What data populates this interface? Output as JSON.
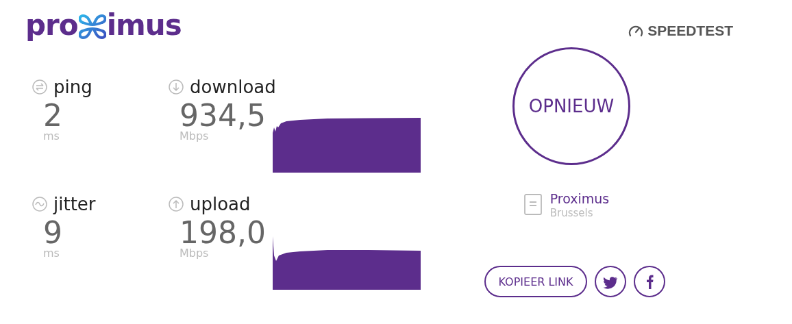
{
  "logo": {
    "before": "pro",
    "after": "imus"
  },
  "brand": {
    "label": "SPEEDTEST"
  },
  "metrics": [
    {
      "kind": "latency",
      "label": "ping",
      "value": "2",
      "unit": "ms"
    },
    {
      "kind": "speed",
      "label": "download",
      "value": "934,5",
      "unit": "Mbps"
    },
    {
      "kind": "latency",
      "label": "jitter",
      "value": "9",
      "unit": "ms"
    },
    {
      "kind": "speed",
      "label": "upload",
      "value": "198,0",
      "unit": "Mbps"
    }
  ],
  "restart_button": "OPNIEUW",
  "server": {
    "name": "Proximus",
    "location": "Brussels"
  },
  "share": {
    "copy_link": "KOPIEER LINK"
  }
}
